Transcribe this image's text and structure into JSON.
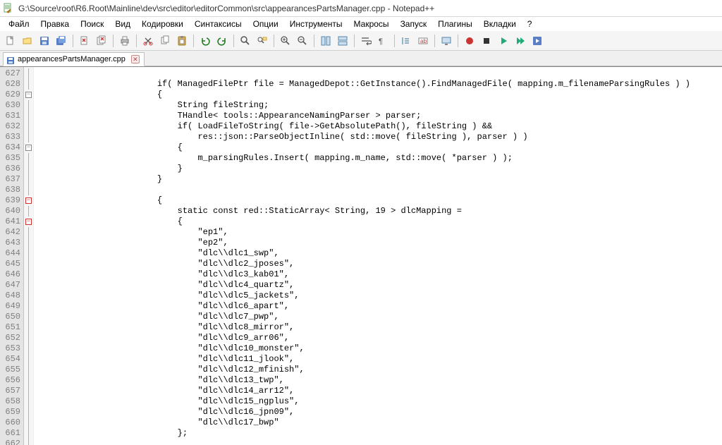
{
  "window": {
    "title": "G:\\Source\\root\\R6.Root\\Mainline\\dev\\src\\editor\\editorCommon\\src\\appearancesPartsManager.cpp - Notepad++"
  },
  "menubar": [
    "Файл",
    "Правка",
    "Поиск",
    "Вид",
    "Кодировки",
    "Синтаксисы",
    "Опции",
    "Инструменты",
    "Макросы",
    "Запуск",
    "Плагины",
    "Вкладки",
    "?"
  ],
  "toolbar_icons": [
    "new-file-icon",
    "open-file-icon",
    "save-icon",
    "save-all-icon",
    "|",
    "close-icon",
    "close-all-icon",
    "|",
    "print-icon",
    "|",
    "cut-icon",
    "copy-icon",
    "paste-icon",
    "|",
    "undo-icon",
    "redo-icon",
    "|",
    "find-icon",
    "replace-icon",
    "|",
    "zoom-in-icon",
    "zoom-out-icon",
    "|",
    "sync-v-icon",
    "sync-h-icon",
    "|",
    "wrap-icon",
    "show-all-chars-icon",
    "|",
    "indent-guide-icon",
    "lang-icon",
    "|",
    "monitor-icon",
    "|",
    "record-macro-icon",
    "stop-macro-icon",
    "play-macro-icon",
    "play-multi-icon",
    "save-macro-icon"
  ],
  "tab": {
    "label": "appearancesPartsManager.cpp"
  },
  "first_line_number": 627,
  "fold_markers": {
    "629": "minus",
    "634": "minus",
    "639": "minus-red",
    "641": "minus-red"
  },
  "code_lines": [
    "",
    "                        if( ManagedFilePtr file = ManagedDepot::GetInstance().FindManagedFile( mapping.m_filenameParsingRules ) )",
    "                        {",
    "                            String fileString;",
    "                            THandle< tools::AppearanceNamingParser > parser;",
    "                            if( LoadFileToString( file->GetAbsolutePath(), fileString ) &&",
    "                                res::json::ParseObjectInline( std::move( fileString ), parser ) )",
    "                            {",
    "                                m_parsingRules.Insert( mapping.m_name, std::move( *parser ) );",
    "                            }",
    "                        }",
    "",
    "                        {",
    "                            static const red::StaticArray< String, 19 > dlcMapping =",
    "                            {",
    "                                \"ep1\",",
    "                                \"ep2\",",
    "                                \"dlc\\\\dlc1_swp\",",
    "                                \"dlc\\\\dlc2_jposes\",",
    "                                \"dlc\\\\dlc3_kab01\",",
    "                                \"dlc\\\\dlc4_quartz\",",
    "                                \"dlc\\\\dlc5_jackets\",",
    "                                \"dlc\\\\dlc6_apart\",",
    "                                \"dlc\\\\dlc7_pwp\",",
    "                                \"dlc\\\\dlc8_mirror\",",
    "                                \"dlc\\\\dlc9_arr06\",",
    "                                \"dlc\\\\dlc10_monster\",",
    "                                \"dlc\\\\dlc11_jlook\",",
    "                                \"dlc\\\\dlc12_mfinish\",",
    "                                \"dlc\\\\dlc13_twp\",",
    "                                \"dlc\\\\dlc14_arr12\",",
    "                                \"dlc\\\\dlc15_ngplus\",",
    "                                \"dlc\\\\dlc16_jpn09\",",
    "                                \"dlc\\\\dlc17_bwp\"",
    "                            };",
    ""
  ]
}
